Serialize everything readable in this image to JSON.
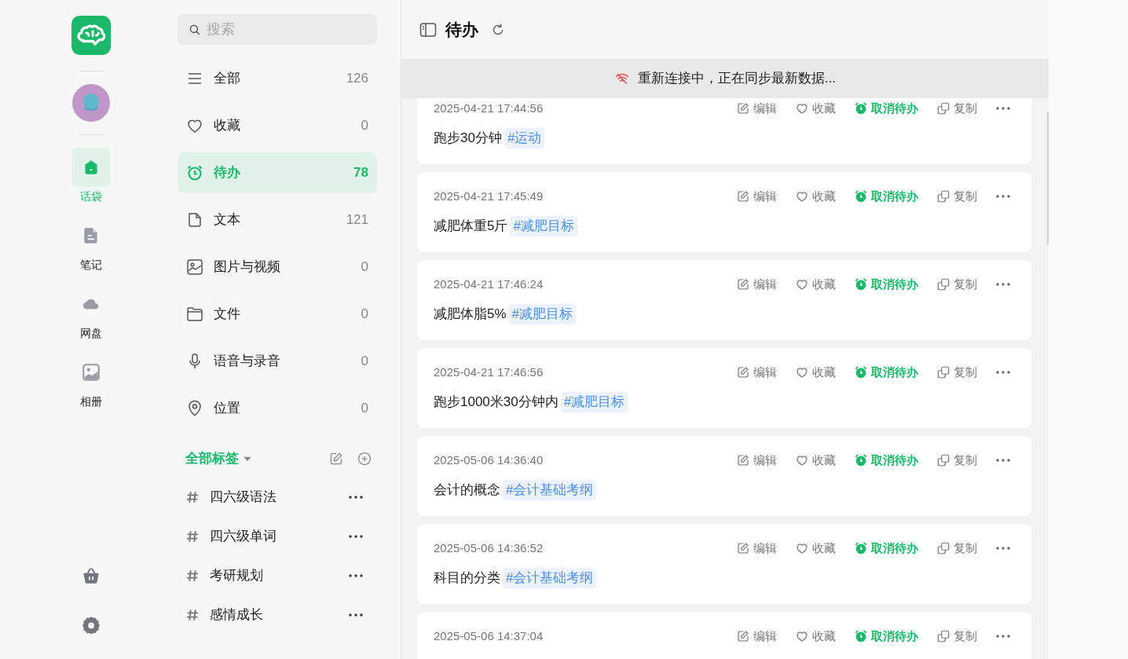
{
  "rail": {
    "items": [
      {
        "kind": "home",
        "label": "话袋",
        "selected": true
      },
      {
        "kind": "note",
        "label": "笔记",
        "selected": false
      },
      {
        "kind": "cloud",
        "label": "网盘",
        "selected": false
      },
      {
        "kind": "photo",
        "label": "相册",
        "selected": false
      }
    ]
  },
  "sidebar": {
    "search": {
      "placeholder": "搜索"
    },
    "categories": [
      {
        "kind": "all",
        "label": "全部",
        "count": "126",
        "selected": false
      },
      {
        "kind": "favorite",
        "label": "收藏",
        "count": "0",
        "selected": false
      },
      {
        "kind": "todo",
        "label": "待办",
        "count": "78",
        "selected": true
      },
      {
        "kind": "text",
        "label": "文本",
        "count": "121",
        "selected": false
      },
      {
        "kind": "image",
        "label": "图片与视频",
        "count": "0",
        "selected": false
      },
      {
        "kind": "file",
        "label": "文件",
        "count": "0",
        "selected": false
      },
      {
        "kind": "voice",
        "label": "语音与录音",
        "count": "0",
        "selected": false
      },
      {
        "kind": "location",
        "label": "位置",
        "count": "0",
        "selected": false
      }
    ],
    "tags_title": "全部标签",
    "tags": [
      {
        "name": "四六级语法"
      },
      {
        "name": "四六级单词"
      },
      {
        "name": "考研规划"
      },
      {
        "name": "感情成长"
      }
    ]
  },
  "main": {
    "title": "待办",
    "banner": "重新连接中，正在同步最新数据...",
    "notes": [
      {
        "time": "2025-04-21 17:44:56",
        "content": "跑步30分钟",
        "tag": "#运动",
        "actions": [
          {
            "kind": "edit",
            "label": "编辑"
          },
          {
            "kind": "favorite",
            "label": "收藏"
          },
          {
            "kind": "untodo",
            "label": "取消待办"
          },
          {
            "kind": "copy",
            "label": "复制"
          }
        ]
      },
      {
        "time": "2025-04-21 17:45:49",
        "content": "减肥体重5斤",
        "tag": "#减肥目标",
        "actions": [
          {
            "kind": "edit",
            "label": "编辑"
          },
          {
            "kind": "favorite",
            "label": "收藏"
          },
          {
            "kind": "untodo",
            "label": "取消待办"
          },
          {
            "kind": "copy",
            "label": "复制"
          }
        ]
      },
      {
        "time": "2025-04-21 17:46:24",
        "content": "减肥体脂5%",
        "tag": "#减肥目标",
        "actions": [
          {
            "kind": "edit",
            "label": "编辑"
          },
          {
            "kind": "favorite",
            "label": "收藏"
          },
          {
            "kind": "untodo",
            "label": "取消待办"
          },
          {
            "kind": "copy",
            "label": "复制"
          }
        ]
      },
      {
        "time": "2025-04-21 17:46:56",
        "content": "跑步1000米30分钟内",
        "tag": "#减肥目标",
        "actions": [
          {
            "kind": "edit",
            "label": "编辑"
          },
          {
            "kind": "favorite",
            "label": "收藏"
          },
          {
            "kind": "untodo",
            "label": "取消待办"
          },
          {
            "kind": "copy",
            "label": "复制"
          }
        ]
      },
      {
        "time": "2025-05-06 14:36:40",
        "content": "会计的概念",
        "tag": "#会计基础考纲",
        "actions": [
          {
            "kind": "edit",
            "label": "编辑"
          },
          {
            "kind": "favorite",
            "label": "收藏"
          },
          {
            "kind": "untodo",
            "label": "取消待办"
          },
          {
            "kind": "copy",
            "label": "复制"
          }
        ]
      },
      {
        "time": "2025-05-06 14:36:52",
        "content": "科目的分类",
        "tag": "#会计基础考纲",
        "actions": [
          {
            "kind": "edit",
            "label": "编辑"
          },
          {
            "kind": "favorite",
            "label": "收藏"
          },
          {
            "kind": "untodo",
            "label": "取消待办"
          },
          {
            "kind": "copy",
            "label": "复制"
          }
        ]
      },
      {
        "time": "2025-05-06 14:37:04",
        "actions": [
          {
            "kind": "edit",
            "label": "编辑"
          },
          {
            "kind": "favorite",
            "label": "收藏"
          },
          {
            "kind": "untodo",
            "label": "取消待办"
          },
          {
            "kind": "copy",
            "label": "复制"
          }
        ]
      }
    ]
  }
}
